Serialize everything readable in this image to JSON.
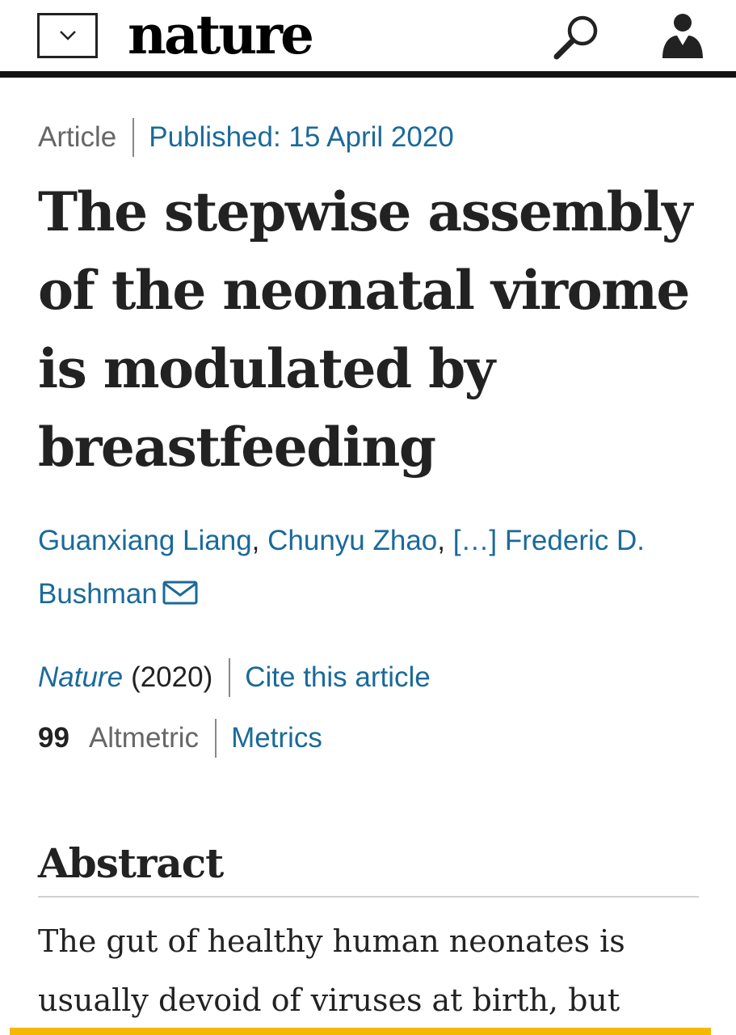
{
  "header": {
    "logo": "nature",
    "menu_icon": "chevron-down-icon",
    "search_icon": "search-icon",
    "account_icon": "user-icon"
  },
  "meta": {
    "type": "Article",
    "published": "Published: 15 April 2020"
  },
  "title": "The stepwise assembly of the neonatal virome is modulated by breastfeeding",
  "authors": {
    "first": "Guanxiang Liang",
    "sep1": ", ",
    "second": "Chunyu Zhao",
    "sep2": ", ",
    "expand": "[…]",
    "last": "Frederic D. Bushman",
    "mail_icon": "mail-icon"
  },
  "citation": {
    "journal": "Nature",
    "year": "(2020)",
    "cite": "Cite this article"
  },
  "metrics": {
    "count": "99",
    "label": "Altmetric",
    "link": "Metrics"
  },
  "abstract": {
    "heading": "Abstract",
    "text": "The gut of healthy human neonates is usually devoid of viruses at birth, but"
  },
  "colors": {
    "link": "#1a6a9a",
    "text": "#222222",
    "muted": "#666666",
    "accent_bar": "#f5b800"
  }
}
